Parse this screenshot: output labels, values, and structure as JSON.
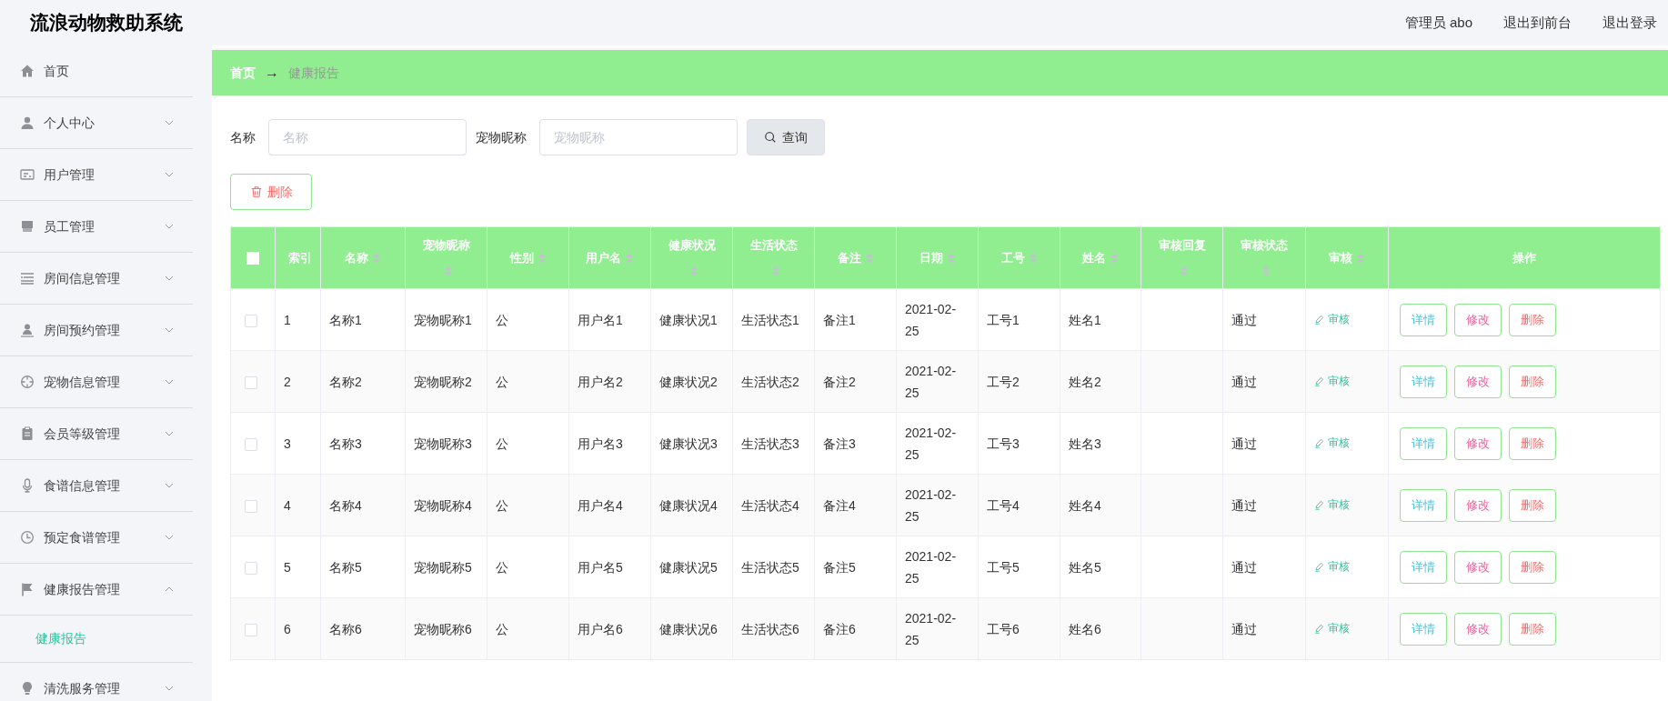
{
  "header": {
    "title": "流浪动物救助系统",
    "links": [
      "管理员 abo",
      "退出到前台",
      "退出登录"
    ]
  },
  "sidebar": {
    "items": [
      {
        "label": "首页",
        "selected": false
      },
      {
        "label": "个人中心",
        "expanded": false
      },
      {
        "label": "用户管理",
        "expanded": false
      },
      {
        "label": "员工管理",
        "expanded": false
      },
      {
        "label": "房间信息管理",
        "expanded": false
      },
      {
        "label": "房间预约管理",
        "expanded": false
      },
      {
        "label": "宠物信息管理",
        "expanded": false
      },
      {
        "label": "会员等级管理",
        "expanded": false
      },
      {
        "label": "食谱信息管理",
        "expanded": false
      },
      {
        "label": "预定食谱管理",
        "expanded": false
      },
      {
        "label": "健康报告管理",
        "expanded": true,
        "children": [
          {
            "label": "健康报告",
            "selected": true
          }
        ]
      },
      {
        "label": "清洗服务管理",
        "expanded": false
      }
    ]
  },
  "breadcrumb": [
    "首页",
    "→",
    "健康报告"
  ],
  "search": {
    "fields": [
      {
        "label": "名称",
        "placeholder": "名称"
      },
      {
        "label": "宠物昵称",
        "placeholder": "宠物昵称"
      }
    ],
    "button": "查询"
  },
  "delete_button": "删除",
  "table": {
    "select_all": {
      "checked": false
    },
    "columns": [
      {
        "label": "索引",
        "sortable": false
      },
      {
        "label": "名称",
        "sortable": true
      },
      {
        "label": "宠物昵称",
        "sortable": true
      },
      {
        "label": "性别",
        "sortable": true
      },
      {
        "label": "用户名",
        "sortable": true
      },
      {
        "label": "健康状况",
        "sortable": true
      },
      {
        "label": "生活状态",
        "sortable": true
      },
      {
        "label": "备注",
        "sortable": true
      },
      {
        "label": "日期",
        "sortable": true
      },
      {
        "label": "工号",
        "sortable": true
      },
      {
        "label": "姓名",
        "sortable": true
      },
      {
        "label": "审核回复",
        "sortable": true
      },
      {
        "label": "审核状态",
        "sortable": true
      },
      {
        "label": "审核",
        "sortable": true
      },
      {
        "label": "操作",
        "sortable": false
      }
    ],
    "rows": [
      {
        "checked": false,
        "cells": [
          "1",
          "名称1",
          "宠物昵称1",
          "公",
          "用户名1",
          "健康状况1",
          "生活状态1",
          "备注1",
          "2021-02-25",
          "工号1",
          "姓名1",
          null,
          "通过"
        ],
        "review": "审核",
        "actions": [
          {
            "kind": "detail",
            "label": "详情"
          },
          {
            "kind": "edit",
            "label": "修改"
          },
          {
            "kind": "delete",
            "label": "删除"
          }
        ]
      },
      {
        "checked": false,
        "cells": [
          "2",
          "名称2",
          "宠物昵称2",
          "公",
          "用户名2",
          "健康状况2",
          "生活状态2",
          "备注2",
          "2021-02-25",
          "工号2",
          "姓名2",
          null,
          "通过"
        ],
        "review": "审核",
        "actions": [
          {
            "kind": "detail",
            "label": "详情"
          },
          {
            "kind": "edit",
            "label": "修改"
          },
          {
            "kind": "delete",
            "label": "删除"
          }
        ]
      },
      {
        "checked": false,
        "cells": [
          "3",
          "名称3",
          "宠物昵称3",
          "公",
          "用户名3",
          "健康状况3",
          "生活状态3",
          "备注3",
          "2021-02-25",
          "工号3",
          "姓名3",
          null,
          "通过"
        ],
        "review": "审核",
        "actions": [
          {
            "kind": "detail",
            "label": "详情"
          },
          {
            "kind": "edit",
            "label": "修改"
          },
          {
            "kind": "delete",
            "label": "删除"
          }
        ]
      },
      {
        "checked": false,
        "cells": [
          "4",
          "名称4",
          "宠物昵称4",
          "公",
          "用户名4",
          "健康状况4",
          "生活状态4",
          "备注4",
          "2021-02-25",
          "工号4",
          "姓名4",
          null,
          "通过"
        ],
        "review": "审核",
        "actions": [
          {
            "kind": "detail",
            "label": "详情"
          },
          {
            "kind": "edit",
            "label": "修改"
          },
          {
            "kind": "delete",
            "label": "删除"
          }
        ]
      },
      {
        "checked": false,
        "cells": [
          "5",
          "名称5",
          "宠物昵称5",
          "公",
          "用户名5",
          "健康状况5",
          "生活状态5",
          "备注5",
          "2021-02-25",
          "工号5",
          "姓名5",
          null,
          "通过"
        ],
        "review": "审核",
        "actions": [
          {
            "kind": "detail",
            "label": "详情"
          },
          {
            "kind": "edit",
            "label": "修改"
          },
          {
            "kind": "delete",
            "label": "删除"
          }
        ]
      },
      {
        "checked": false,
        "cells": [
          "6",
          "名称6",
          "宠物昵称6",
          "公",
          "用户名6",
          "健康状况6",
          "生活状态6",
          "备注6",
          "2021-02-25",
          "工号6",
          "姓名6",
          null,
          "通过"
        ],
        "review": "审核",
        "actions": [
          {
            "kind": "detail",
            "label": "详情"
          },
          {
            "kind": "edit",
            "label": "修改"
          },
          {
            "kind": "delete",
            "label": "删除"
          }
        ]
      }
    ]
  }
}
